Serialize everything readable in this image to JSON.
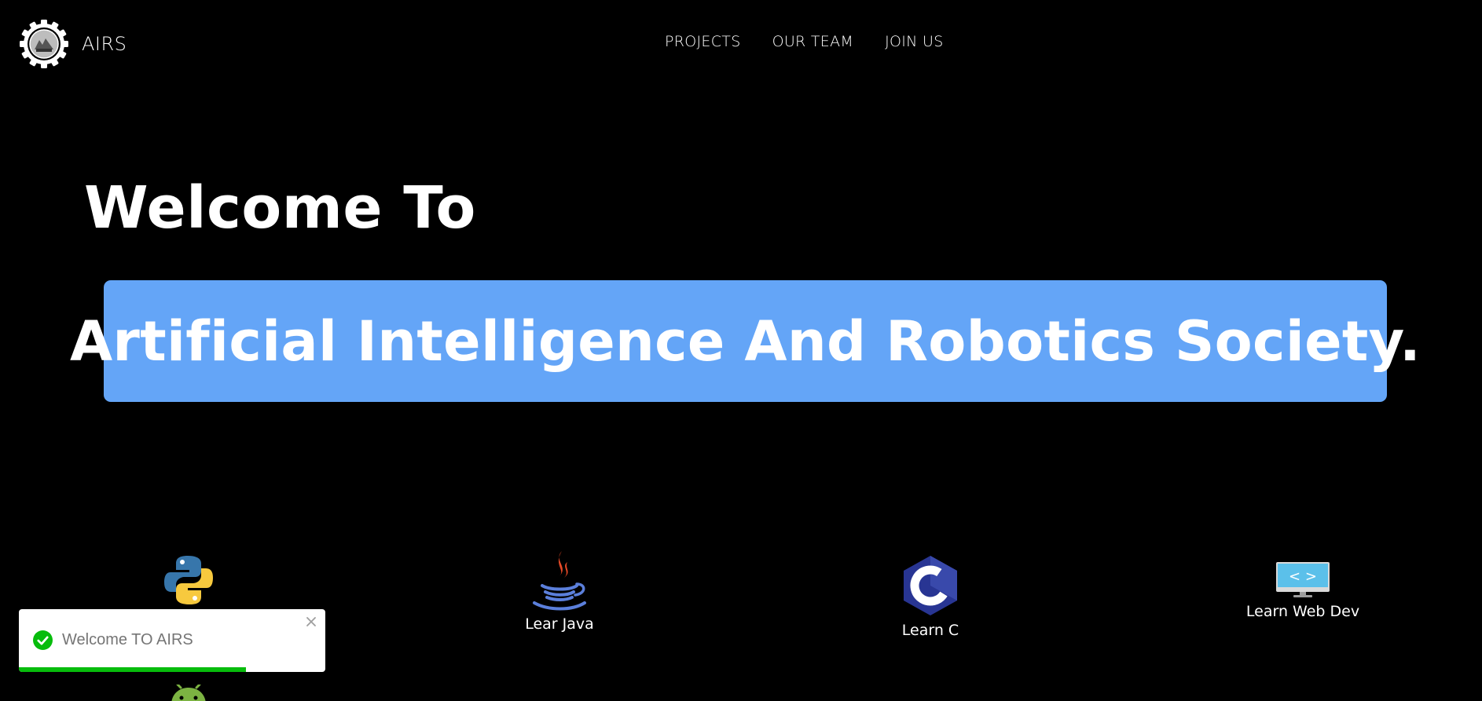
{
  "brand": {
    "name": "AIRS",
    "logo_icon": "gear-logo-icon"
  },
  "nav": [
    {
      "label": "PROJECTS"
    },
    {
      "label": "OUR TEAM"
    },
    {
      "label": "JOIN US"
    }
  ],
  "hero": {
    "welcome": "Welcome To",
    "banner": "Artificial Intelligence And Robotics Society.",
    "banner_color": "#64a5f7"
  },
  "courses": [
    {
      "label": "",
      "icon": "python-icon"
    },
    {
      "label": "Lear Java",
      "icon": "java-icon"
    },
    {
      "label": "Learn C",
      "icon": "c-language-icon"
    },
    {
      "label": "Learn Web Dev",
      "icon": "web-dev-monitor-icon"
    },
    {
      "label": "",
      "icon": "android-icon"
    }
  ],
  "toast": {
    "message": "Welcome TO AIRS",
    "progress": 0.74,
    "success_color": "#07bc0c"
  },
  "colors": {
    "background": "#000000",
    "text": "#ffffff"
  }
}
